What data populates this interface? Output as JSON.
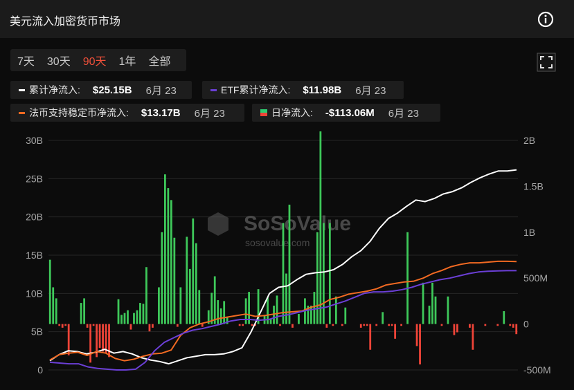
{
  "header": {
    "title": "美元流入加密货币市场"
  },
  "ranges": [
    {
      "label": "7天",
      "active": false
    },
    {
      "label": "30天",
      "active": false
    },
    {
      "label": "90天",
      "active": true
    },
    {
      "label": "1年",
      "active": false
    },
    {
      "label": "全部",
      "active": false
    }
  ],
  "legend": {
    "cumulative": {
      "label": "累计净流入:",
      "value": "$25.15B",
      "date": "6月 23",
      "color": "#ffffff"
    },
    "etf": {
      "label": "ETF累计净流入:",
      "value": "$11.98B",
      "date": "6月 23",
      "color": "#6b3fd6"
    },
    "stablecoin": {
      "label": "法币支持稳定币净流入:",
      "value": "$13.17B",
      "date": "6月 23",
      "color": "#f26a22"
    },
    "daily": {
      "label": "日净流入:",
      "value": "-$113.06M",
      "date": "6月 23"
    }
  },
  "watermark": {
    "brand": "SoSoValue",
    "url": "sosovalue.com"
  },
  "colors": {
    "positive": "#3ec95a",
    "negative": "#f04438",
    "grid": "#262626",
    "axis_text": "#a8a8a8"
  },
  "chart_data": {
    "type": "bar",
    "title": "",
    "left_axis": {
      "ticks": [
        "0",
        "5B",
        "10B",
        "15B",
        "20B",
        "25B",
        "30B"
      ],
      "range": [
        0,
        30
      ]
    },
    "right_axis": {
      "ticks": [
        "-500M",
        "0",
        "500M",
        "1B",
        "1.5B",
        "2B"
      ],
      "range": [
        -500,
        2000
      ]
    },
    "daily_net_inflow_millions": [
      700,
      400,
      280,
      -20,
      -40,
      -20,
      -340,
      0,
      0,
      0,
      230,
      280,
      -40,
      -420,
      -20,
      -360,
      -260,
      -300,
      -320,
      -360,
      0,
      0,
      270,
      100,
      120,
      150,
      -60,
      120,
      150,
      230,
      220,
      620,
      -80,
      -40,
      0,
      400,
      1000,
      1630,
      1480,
      1350,
      940,
      -30,
      400,
      0,
      950,
      600,
      1150,
      880,
      370,
      -30,
      0,
      150,
      340,
      520,
      260,
      170,
      250,
      70,
      0,
      0,
      0,
      -20,
      -20,
      280,
      350,
      -20,
      -20,
      380,
      0,
      100,
      290,
      60,
      200,
      310,
      -20,
      1100,
      550,
      1300,
      -40,
      0,
      110,
      0,
      280,
      200,
      200,
      350,
      1000,
      2100,
      1100,
      -40,
      1100,
      -20,
      300,
      0,
      -20,
      180,
      0,
      0,
      0,
      0,
      -40,
      -20,
      -20,
      -280,
      0,
      -20,
      0,
      130,
      0,
      -20,
      -20,
      -160,
      0,
      -20,
      0,
      1000,
      0,
      0,
      -240,
      -440,
      450,
      0,
      200,
      450,
      300,
      0,
      -20,
      0,
      300,
      0,
      -120,
      -90,
      0,
      0,
      0,
      -40,
      -280,
      0,
      0,
      0,
      -20,
      0,
      0,
      0,
      -20,
      0,
      140,
      0,
      -20,
      -40,
      -110
    ],
    "series": [
      {
        "name": "累计净流入",
        "unit": "B",
        "values": [
          0.2,
          1.0,
          1.5,
          1.4,
          1.1,
          1.3,
          1.7,
          1.2,
          1.4,
          1.1,
          0.6,
          0.3,
          0.1,
          -0.2,
          0.2,
          0.6,
          0.8,
          1.0,
          1.0,
          1.1,
          1.4,
          1.9,
          4.0,
          6.5,
          9.0,
          9.8,
          10.0,
          10.8,
          11.5,
          11.7,
          11.8,
          12.1,
          12.8,
          13.8,
          14.6,
          15.8,
          17.5,
          18.8,
          19.5,
          20.4,
          21.2,
          21.0,
          21.4,
          22.0,
          22.3,
          22.8,
          23.5,
          24.1,
          24.6,
          25.0,
          25.0,
          25.15
        ]
      },
      {
        "name": "法币支持稳定币净流入",
        "unit": "B",
        "values": [
          0.3,
          1.0,
          1.2,
          1.3,
          0.9,
          1.4,
          1.2,
          0.5,
          0.2,
          0.4,
          0.8,
          1.1,
          1.2,
          1.6,
          3.5,
          4.5,
          5.0,
          5.3,
          5.7,
          5.9,
          6.1,
          6.3,
          6.0,
          6.1,
          6.3,
          6.5,
          6.6,
          6.7,
          7.2,
          7.5,
          8.2,
          8.5,
          8.9,
          9.1,
          9.3,
          9.6,
          10.1,
          10.3,
          10.5,
          10.6,
          11.0,
          11.6,
          12.0,
          12.5,
          12.8,
          13.0,
          13.0,
          13.1,
          13.2,
          13.2,
          13.17
        ]
      },
      {
        "name": "ETF累计净流入",
        "unit": "B",
        "values": [
          0.0,
          -0.1,
          -0.2,
          -0.2,
          -0.6,
          -0.8,
          -0.9,
          -1.0,
          -1.0,
          -0.9,
          0.0,
          1.5,
          2.6,
          3.2,
          3.8,
          4.2,
          4.4,
          4.7,
          5.0,
          5.4,
          5.6,
          5.6,
          5.5,
          5.6,
          6.0,
          6.2,
          6.5,
          6.8,
          7.0,
          7.2,
          7.6,
          8.0,
          8.5,
          9.0,
          9.2,
          9.2,
          9.3,
          9.5,
          9.8,
          10.2,
          10.5,
          10.8,
          11.0,
          11.3,
          11.6,
          11.8,
          11.9,
          11.95,
          11.98,
          11.98
        ]
      }
    ]
  }
}
